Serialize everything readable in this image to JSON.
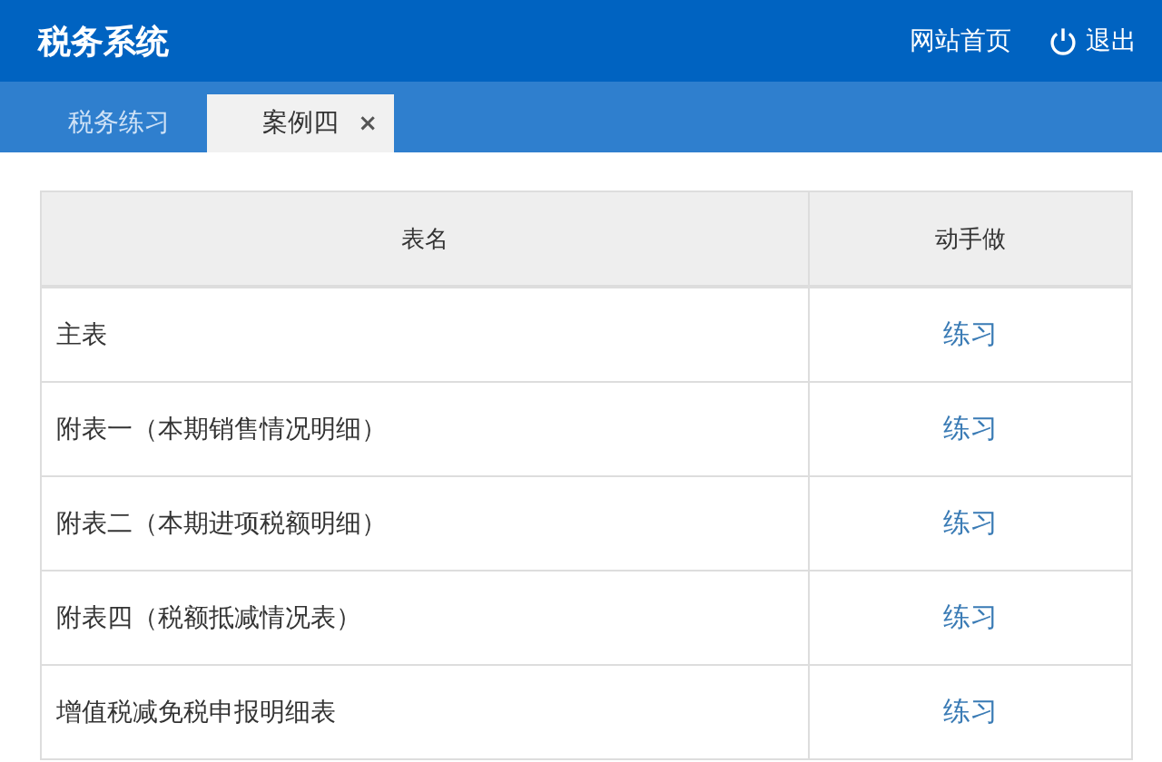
{
  "header": {
    "title": "税务系统",
    "links": [
      {
        "label": "网站首页",
        "kind": "home"
      },
      {
        "label": "退出",
        "kind": "logout"
      }
    ]
  },
  "tabs": [
    {
      "label": "税务练习",
      "selected": false
    },
    {
      "label": "案例四",
      "selected": true,
      "close": "×"
    }
  ],
  "table": {
    "columns": [
      "表名",
      "动手做"
    ],
    "rows": [
      {
        "name": "主表",
        "action": "练习"
      },
      {
        "name": "附表一（本期销售情况明细）",
        "action": "练习"
      },
      {
        "name": "附表二（本期进项税额明细）",
        "action": "练习"
      },
      {
        "name": "附表四（税额抵减情况表）",
        "action": "练习"
      },
      {
        "name": "增值税减免税申报明细表",
        "action": "练习"
      }
    ]
  }
}
